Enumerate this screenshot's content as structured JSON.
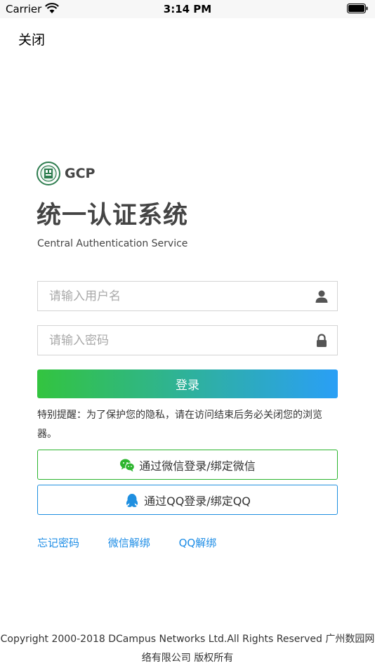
{
  "status_bar": {
    "carrier": "Carrier",
    "time": "3:14 PM"
  },
  "nav": {
    "close_label": "关闭"
  },
  "brand": {
    "name": "GCP"
  },
  "header": {
    "title": "统一认证系统",
    "subtitle": "Central Authentication Service"
  },
  "form": {
    "username_placeholder": "请输入用户名",
    "password_placeholder": "请输入密码",
    "login_label": "登录"
  },
  "notice": "特别提醒：为了保护您的隐私，请在访问结束后务必关闭您的浏览器。",
  "alt_login": {
    "wechat_label": "通过微信登录/绑定微信",
    "qq_label": "通过QQ登录/绑定QQ"
  },
  "links": {
    "forgot_password": "忘记密码",
    "wechat_unbind": "微信解绑",
    "qq_unbind": "QQ解绑"
  },
  "footer": "Copyright  2000-2018 DCampus Networks Ltd.All Rights Reserved 广州数园网络有限公司 版权所有",
  "colors": {
    "wechat_green": "#2cb52e",
    "qq_blue": "#1f8fe0",
    "link_blue": "#1e8de6",
    "gradient_start": "#33c43f",
    "gradient_end": "#2a9ff6"
  }
}
